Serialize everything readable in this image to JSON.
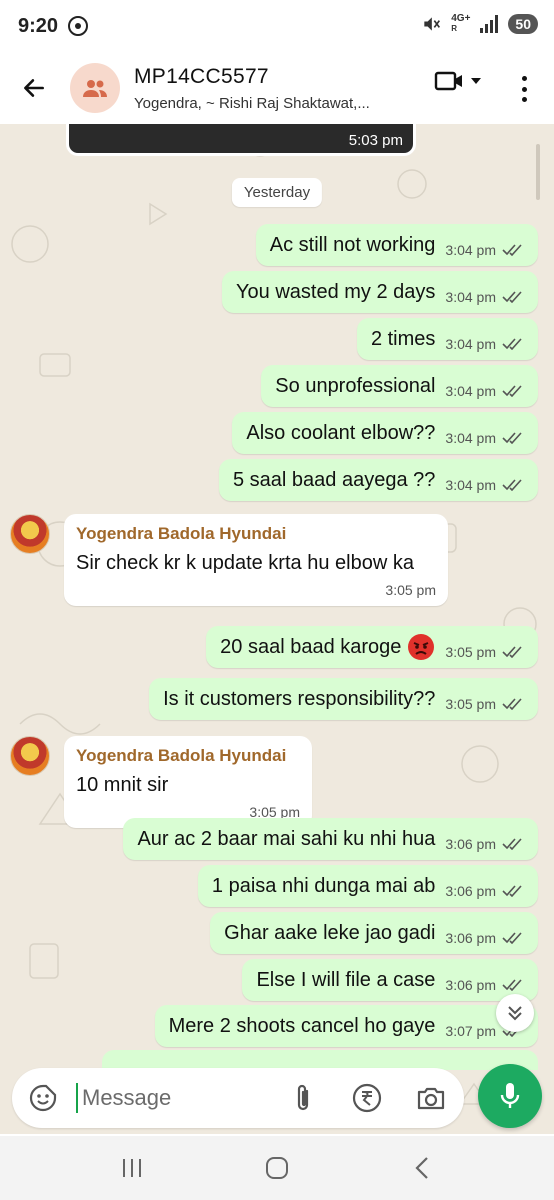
{
  "status_bar": {
    "time": "9:20",
    "network": "4G+",
    "network_sub": "R",
    "battery": "50"
  },
  "header": {
    "title": "MP14CC5577",
    "subtitle": "Yogendra, ~ Rishi Raj Shaktawat,..."
  },
  "media": {
    "time": "5:03 pm"
  },
  "date_chip": "Yesterday",
  "messages": [
    {
      "dir": "out",
      "text": "Ac still not working",
      "time": "3:04 pm"
    },
    {
      "dir": "out",
      "text": "You wasted my 2 days",
      "time": "3:04 pm"
    },
    {
      "dir": "out",
      "text": "2 times",
      "time": "3:04 pm"
    },
    {
      "dir": "out",
      "text": "So unprofessional",
      "time": "3:04 pm"
    },
    {
      "dir": "out",
      "text": "Also coolant elbow??",
      "time": "3:04 pm"
    },
    {
      "dir": "out",
      "text": "5 saal baad aayega  ??",
      "time": "3:04 pm"
    },
    {
      "dir": "in",
      "sender": "Yogendra Badola Hyundai",
      "text": "Sir check kr k update krta hu elbow ka",
      "time": "3:05 pm"
    },
    {
      "dir": "out",
      "text": "20 saal baad karoge",
      "emoji": "angry-face",
      "time": "3:05 pm"
    },
    {
      "dir": "out",
      "text": "Is it customers responsibility??",
      "time": "3:05 pm"
    },
    {
      "dir": "in",
      "sender": "Yogendra Badola Hyundai",
      "text": "10 mnit sir",
      "time": "3:05 pm"
    },
    {
      "dir": "out",
      "text": "Aur ac 2 baar mai sahi ku nhi hua",
      "time": "3:06 pm"
    },
    {
      "dir": "out",
      "text": "1 paisa nhi dunga mai ab",
      "time": "3:06 pm"
    },
    {
      "dir": "out",
      "text": "Ghar aake leke jao gadi",
      "time": "3:06 pm"
    },
    {
      "dir": "out",
      "text": "Else I will file a case",
      "time": "3:06 pm"
    },
    {
      "dir": "out",
      "text": "Mere 2 shoots cancel ho gaye",
      "time": "3:07 pm"
    }
  ],
  "composer": {
    "placeholder": "Message"
  },
  "colors": {
    "outgoing_bubble": "#d9fdd3",
    "incoming_bubble": "#ffffff",
    "chat_background": "#efe9de",
    "sender_name": "#a0682b",
    "read_ticks": "#53bdeb",
    "accent_green": "#1daa61"
  },
  "icons": [
    "whatsapp-icon",
    "mute-icon",
    "back-arrow-icon",
    "group-icon",
    "video-call-icon",
    "chevron-down-icon",
    "more-vert-icon",
    "double-check-icon",
    "scroll-down-icon",
    "emoji-sticker-icon",
    "attach-icon",
    "rupee-icon",
    "camera-icon",
    "mic-icon",
    "recents-icon",
    "home-icon",
    "back-icon"
  ]
}
